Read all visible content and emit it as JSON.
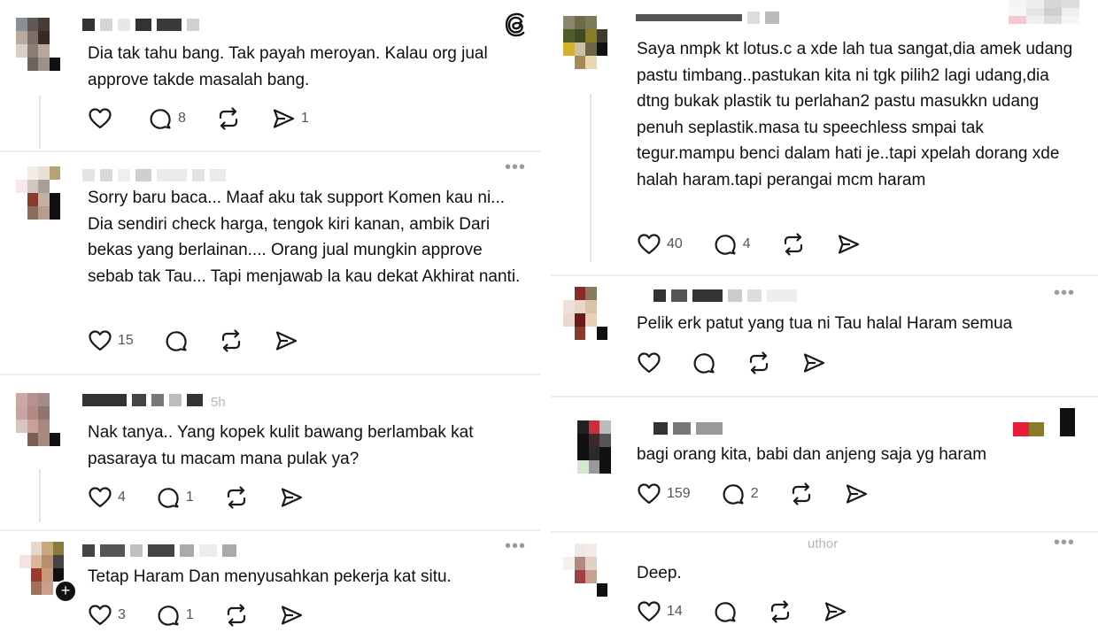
{
  "app": {
    "logo_icon": "threads-logo-icon"
  },
  "left_column": [
    {
      "text": "Dia tak tahu bang. Tak payah meroyan. Kalau org jual approve takde masalah bang.",
      "likes": "",
      "replies": "8",
      "reposts": "",
      "shares": "1"
    },
    {
      "text": "Sorry baru baca... Maaf aku tak support Komen kau ni... Dia sendiri check harga, tengok kiri kanan, ambik Dari bekas yang berlainan.... Orang jual mungkin approve sebab tak Tau... Tapi menjawab la kau dekat Akhirat nanti.",
      "likes": "15",
      "replies": "",
      "reposts": "",
      "shares": ""
    },
    {
      "text": "Nak tanya.. Yang kopek kulit bawang berlambak kat pasaraya tu macam mana pulak ya?",
      "timestamp": "5h",
      "likes": "4",
      "replies": "1",
      "reposts": "",
      "shares": ""
    },
    {
      "text": "Tetap Haram Dan menyusahkan pekerja kat situ.",
      "likes": "3",
      "replies": "1",
      "reposts": "",
      "shares": ""
    }
  ],
  "right_column": [
    {
      "text": "Saya nmpk kt lotus.c   a xde lah tua sangat,dia amek udang pastu timbang..pastukan kita ni tgk pilih2 lagi udang,dia dtng bukak plastik tu perlahan2 pastu masukkn udang penuh seplastik.masa tu speechless smpai tak tegur.mampu benci dalam hati je..tapi xpelah dorang xde halah haram.tapi perangai mcm haram",
      "likes": "40",
      "replies": "4",
      "reposts": "",
      "shares": ""
    },
    {
      "text": "Pelik erk patut yang tua ni Tau halal Haram semua",
      "likes": "",
      "replies": "",
      "reposts": "",
      "shares": ""
    },
    {
      "text": "bagi orang kita, babi dan anjeng saja yg haram",
      "likes": "159",
      "replies": "2",
      "reposts": "",
      "shares": ""
    },
    {
      "text": "Deep.",
      "author_tag": "uthor",
      "likes": "14",
      "replies": "",
      "reposts": "",
      "shares": ""
    }
  ],
  "more_label": "•••",
  "plus_label": "+",
  "colors": {
    "text": "#101010",
    "muted": "#555555",
    "divider": "#ececec",
    "icon": "#1a1a1a"
  }
}
